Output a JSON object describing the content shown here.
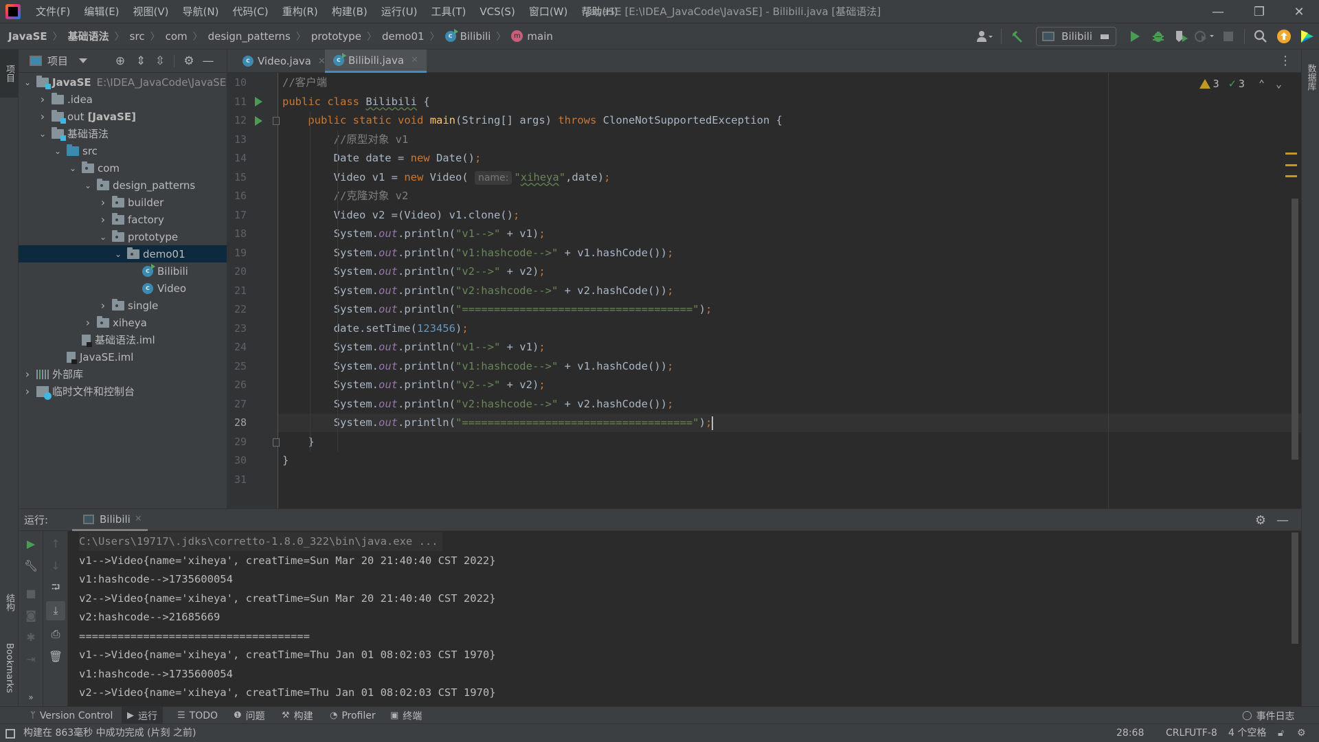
{
  "titlebar": {
    "menus": [
      "文件(F)",
      "编辑(E)",
      "视图(V)",
      "导航(N)",
      "代码(C)",
      "重构(R)",
      "构建(B)",
      "运行(U)",
      "工具(T)",
      "VCS(S)",
      "窗口(W)",
      "帮助(H)"
    ],
    "window_title": "JavaSE [E:\\IDEA_JavaCode\\JavaSE] - Bilibili.java [基础语法]",
    "minimize": "—",
    "restore": "❐",
    "close": "✕"
  },
  "breadcrumb": {
    "items": [
      "JavaSE",
      "基础语法",
      "src",
      "com",
      "design_patterns",
      "prototype",
      "demo01",
      "Bilibili",
      "main"
    ],
    "separator": "〉"
  },
  "toolbar": {
    "run_config": "Bilibili",
    "icons": [
      "user-icon",
      "build-hammer-icon",
      "run-icon",
      "debug-icon",
      "coverage-icon",
      "profile-icon",
      "stop-icon",
      "search-icon",
      "update-icon",
      "toolbox-icon"
    ]
  },
  "left_strip": {
    "project_tab": "项目",
    "structure_tab": "结构",
    "bookmarks_tab": "Bookmarks"
  },
  "right_strip": {
    "database_tab": "数据库"
  },
  "project_panel": {
    "title": "项目",
    "tree": [
      {
        "label": "JavaSE",
        "path": "E:\\IDEA_JavaCode\\JavaSE",
        "depth": 0,
        "expanded": true,
        "type": "module",
        "bold": true
      },
      {
        "label": ".idea",
        "depth": 1,
        "expanded": false,
        "type": "folder"
      },
      {
        "label": "out",
        "suffix": "[JavaSE]",
        "depth": 1,
        "expanded": false,
        "type": "module"
      },
      {
        "label": "基础语法",
        "depth": 1,
        "expanded": true,
        "type": "module"
      },
      {
        "label": "src",
        "depth": 2,
        "expanded": true,
        "type": "src"
      },
      {
        "label": "com",
        "depth": 3,
        "expanded": true,
        "type": "package"
      },
      {
        "label": "design_patterns",
        "depth": 4,
        "expanded": true,
        "type": "package"
      },
      {
        "label": "builder",
        "depth": 5,
        "expanded": false,
        "type": "package"
      },
      {
        "label": "factory",
        "depth": 5,
        "expanded": false,
        "type": "package"
      },
      {
        "label": "prototype",
        "depth": 5,
        "expanded": true,
        "type": "package"
      },
      {
        "label": "demo01",
        "depth": 6,
        "expanded": true,
        "type": "package",
        "selected": true
      },
      {
        "label": "Bilibili",
        "depth": 7,
        "type": "class-run"
      },
      {
        "label": "Video",
        "depth": 7,
        "type": "class"
      },
      {
        "label": "single",
        "depth": 5,
        "expanded": false,
        "type": "package"
      },
      {
        "label": "xiheya",
        "depth": 4,
        "expanded": false,
        "type": "package"
      },
      {
        "label": "基础语法.iml",
        "depth": 3,
        "type": "iml"
      },
      {
        "label": "JavaSE.iml",
        "depth": 2,
        "type": "iml"
      },
      {
        "label": "外部库",
        "depth": 0,
        "expanded": false,
        "type": "library"
      },
      {
        "label": "临时文件和控制台",
        "depth": 0,
        "expanded": false,
        "type": "scratch"
      }
    ]
  },
  "editor": {
    "tabs": [
      {
        "label": "Video.java",
        "active": false
      },
      {
        "label": "Bilibili.java",
        "active": true
      }
    ],
    "inspections": {
      "warnings": "3",
      "weak_warnings": "3"
    },
    "current_line": 28,
    "lines": [
      {
        "n": "10",
        "text": "//客户端"
      },
      {
        "n": "11",
        "text": "public class Bilibili {"
      },
      {
        "n": "12",
        "text": "    public static void main(String[] args) throws CloneNotSupportedException {"
      },
      {
        "n": "13",
        "text": "        //原型对象 v1"
      },
      {
        "n": "14",
        "text": "        Date date = new Date();"
      },
      {
        "n": "15",
        "text": "        Video v1 = new Video( name: \"xiheya\",date);"
      },
      {
        "n": "16",
        "text": "        //克隆对象 v2"
      },
      {
        "n": "17",
        "text": "        Video v2 =(Video) v1.clone();"
      },
      {
        "n": "18",
        "text": "        System.out.println(\"v1-->\" + v1);"
      },
      {
        "n": "19",
        "text": "        System.out.println(\"v1:hashcode-->\" + v1.hashCode());"
      },
      {
        "n": "20",
        "text": "        System.out.println(\"v2-->\" + v2);"
      },
      {
        "n": "21",
        "text": "        System.out.println(\"v2:hashcode-->\" + v2.hashCode());"
      },
      {
        "n": "22",
        "text": "        System.out.println(\"====================================\");"
      },
      {
        "n": "23",
        "text": "        date.setTime(123456);"
      },
      {
        "n": "24",
        "text": "        System.out.println(\"v1-->\" + v1);"
      },
      {
        "n": "25",
        "text": "        System.out.println(\"v1:hashcode-->\" + v1.hashCode());"
      },
      {
        "n": "26",
        "text": "        System.out.println(\"v2-->\" + v2);"
      },
      {
        "n": "27",
        "text": "        System.out.println(\"v2:hashcode-->\" + v2.hashCode());"
      },
      {
        "n": "28",
        "text": "        System.out.println(\"====================================\");"
      },
      {
        "n": "29",
        "text": "    }"
      },
      {
        "n": "30",
        "text": "}"
      },
      {
        "n": "31",
        "text": ""
      }
    ]
  },
  "run_panel": {
    "title": "运行:",
    "tab": "Bilibili",
    "console": [
      "C:\\Users\\19717\\.jdks\\corretto-1.8.0_322\\bin\\java.exe ...",
      "v1-->Video{name='xiheya', creatTime=Sun Mar 20 21:40:40 CST 2022}",
      "v1:hashcode-->1735600054",
      "v2-->Video{name='xiheya', creatTime=Sun Mar 20 21:40:40 CST 2022}",
      "v2:hashcode-->21685669",
      "====================================",
      "v1-->Video{name='xiheya', creatTime=Thu Jan 01 08:02:03 CST 1970}",
      "v1:hashcode-->1735600054",
      "v2-->Video{name='xiheya', creatTime=Thu Jan 01 08:02:03 CST 1970}"
    ]
  },
  "tool_bar": {
    "items": [
      {
        "label": "Version Control",
        "icon": "ᛘ"
      },
      {
        "label": "运行",
        "icon": "▶",
        "active": true
      },
      {
        "label": "TODO",
        "icon": "☰"
      },
      {
        "label": "问题",
        "icon": "❶"
      },
      {
        "label": "构建",
        "icon": "⚒"
      },
      {
        "label": "Profiler",
        "icon": "◔"
      },
      {
        "label": "终端",
        "icon": "▣"
      }
    ],
    "event_log": "事件日志"
  },
  "status_bar": {
    "message": "构建在 863毫秒 中成功完成 (片刻 之前)",
    "position": "28:68",
    "line_separator": "CRLF",
    "encoding": "UTF-8",
    "indent": "4 个空格"
  }
}
